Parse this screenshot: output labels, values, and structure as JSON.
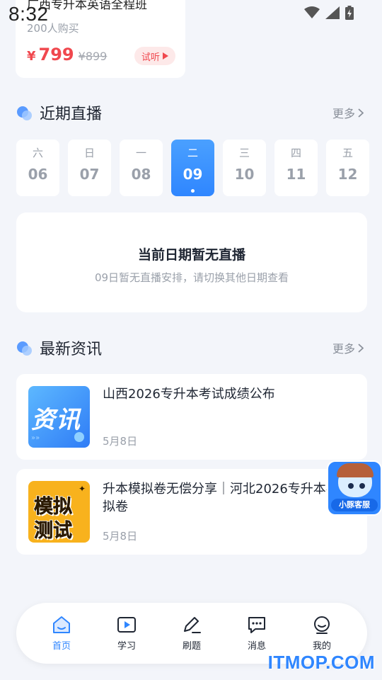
{
  "status_bar": {
    "time": "8:32"
  },
  "course_card": {
    "title": "广西专升本英语全程班",
    "buyers": "200人购买",
    "price_symbol": "¥",
    "price_now": "799",
    "price_old": "¥899",
    "trial_label": "试听"
  },
  "live_section": {
    "title": "近期直播",
    "more_label": "更多",
    "dates": [
      {
        "weekday": "六",
        "day": "06"
      },
      {
        "weekday": "日",
        "day": "07"
      },
      {
        "weekday": "一",
        "day": "08"
      },
      {
        "weekday": "二",
        "day": "09",
        "selected": true
      },
      {
        "weekday": "三",
        "day": "10"
      },
      {
        "weekday": "四",
        "day": "11"
      },
      {
        "weekday": "五",
        "day": "12"
      }
    ],
    "empty_title": "当前日期暂无直播",
    "empty_subtitle": "09日暂无直播安排，请切换其他日期查看"
  },
  "news_section": {
    "title": "最新资讯",
    "more_label": "更多",
    "items": [
      {
        "title": "山西2026专升本考试成绩公布",
        "date": "5月8日",
        "thumb_text": "资讯"
      },
      {
        "title": "升本模拟卷无偿分享｜河北2026专升本考前模拟卷",
        "date": "5月8日",
        "thumb_line1": "模拟",
        "thumb_line2": "测试"
      }
    ]
  },
  "customer_service": {
    "label": "小豚客服"
  },
  "tabbar": {
    "items": [
      {
        "label": "首页",
        "icon": "home-icon",
        "active": true
      },
      {
        "label": "学习",
        "icon": "play-icon"
      },
      {
        "label": "刷题",
        "icon": "pen-icon"
      },
      {
        "label": "消息",
        "icon": "message-icon"
      },
      {
        "label": "我的",
        "icon": "profile-icon"
      }
    ]
  },
  "watermark": "ITMOP.COM",
  "colors": {
    "accent": "#2f86ff",
    "price": "#f0484e",
    "background": "#f3f5fa"
  }
}
